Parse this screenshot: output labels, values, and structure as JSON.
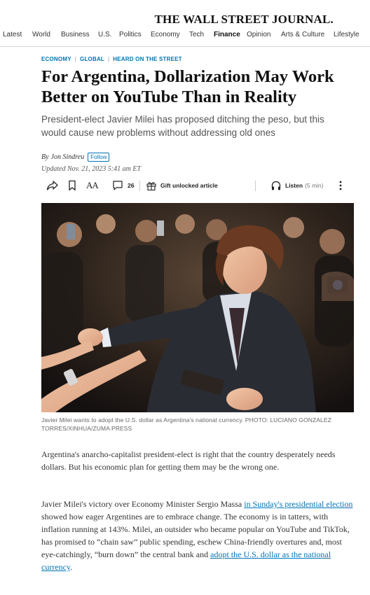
{
  "masthead": "THE WALL STREET JOURNAL.",
  "nav": {
    "items": [
      {
        "label": "Latest",
        "active": false
      },
      {
        "label": "World",
        "active": false
      },
      {
        "label": "Business",
        "active": false
      },
      {
        "label": "U.S.",
        "active": false
      },
      {
        "label": "Politics",
        "active": false
      },
      {
        "label": "Economy",
        "active": false
      },
      {
        "label": "Tech",
        "active": false
      },
      {
        "label": "Finance",
        "active": true
      },
      {
        "label": "Opinion",
        "active": false
      },
      {
        "label": "Arts & Culture",
        "active": false
      },
      {
        "label": "Lifestyle",
        "active": false
      }
    ]
  },
  "article": {
    "sections": [
      "ECONOMY",
      "GLOBAL",
      "HEARD ON THE STREET"
    ],
    "headline": "For Argentina, Dollarization May Work Better on YouTube Than in Reality",
    "dek": "President-elect Javier Milei has proposed ditching the peso, but this would cause new problems without addressing old ones",
    "byline_prefix": "By",
    "author": "Jon Sindreu",
    "follow_label": "Follow",
    "updated": "Updated Nov. 21, 2023 5:41 am ET",
    "toolbar": {
      "share_icon": "share-icon",
      "bookmark_icon": "bookmark-icon",
      "text_size_label": "AA",
      "comment_count": "26",
      "gift_label": "Gift unlocked article",
      "listen_label": "Listen",
      "listen_duration": "(5 min)"
    },
    "caption": "Javier Milei wants to adopt the U.S. dollar as Argentina's national currency. PHOTO: LUCIANO GONZALEZ TORRES/XINHUA/ZUMA PRESS",
    "paragraph1": "Argentina's anarcho-capitalist president-elect is right that the country desperately needs dollars. But his economic plan for getting them may be the wrong one.",
    "paragraph2": {
      "part1": "Javier Milei's victory over Economy Minister Sergio Massa ",
      "link1": "in Sunday's presidential election",
      "part2": " showed how eager Argentines are to embrace change. The economy is in tatters, with inflation running at 143%. Milei, an outsider who became popular on YouTube and TikTok, has promised to “chain saw” public spending, eschew China-friendly overtures and, most eye-catchingly, “burn down” the central bank and ",
      "link2": "adopt the U.S. dollar as the national currency",
      "part3": "."
    }
  },
  "colors": {
    "accent": "#0274b6",
    "headline": "#111111",
    "body": "#333333"
  }
}
